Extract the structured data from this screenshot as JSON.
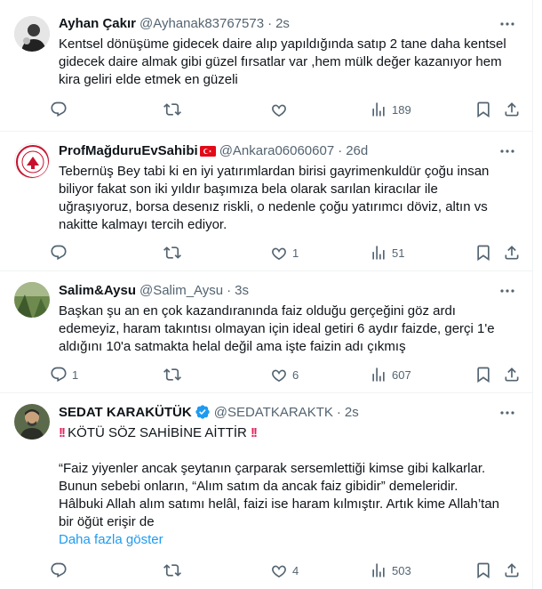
{
  "tweets": [
    {
      "name": "Ayhan Çakır",
      "handle": "@Ayhanak83767573",
      "time": "2s",
      "lines": [
        "Kentsel dönüşüme gidecek daire alıp yapıldığında satıp 2 tane daha kentsel",
        "gidecek daire almak gibi güzel fırsatlar var ,hem mülk değer kazanıyor hem",
        "kira geliri elde etmek en güzeli"
      ],
      "replies": "",
      "retweets": "",
      "likes": "",
      "views": "189"
    },
    {
      "name": "ProfMağduruEvSahibi",
      "handle": "@Ankara06060607",
      "time": "26d",
      "lines": [
        "Tebernüş Bey tabi ki en iyi yatırımlardan birisi gayrimenkuldür çoğu insan",
        "biliyor fakat son iki yıldır başımıza bela olarak sarılan kiracılar ile",
        "uğraşıyoruz, borsa desenız riskli, o nedenle çoğu yatırımcı döviz, altın vs",
        "nakitte kalmayı tercih ediyor."
      ],
      "replies": "",
      "retweets": "",
      "likes": "1",
      "views": "51"
    },
    {
      "name": "Salim&Aysu",
      "handle": "@Salim_Aysu",
      "time": "3s",
      "lines": [
        "Başkan şu an en çok kazandıranında faiz olduğu gerçeğini göz ardı",
        "edemeyiz, haram takıntısı olmayan için ideal getiri 6 aydır faizde, gerçi 1'e",
        "aldığını 10'a satmakta helal değil ama işte faizin adı çıkmış"
      ],
      "replies": "1",
      "retweets": "",
      "likes": "6",
      "views": "607"
    },
    {
      "name": "SEDAT KARAKÜTÜK",
      "handle": "@SEDATKARAKTK",
      "time": "2s",
      "headline": "KÖTÜ SÖZ SAHİBİNE AİTTİR",
      "lines": [
        "“Faiz yiyenler ancak şeytanın çarparak sersemlettiği kimse gibi kalkarlar.",
        "Bunun sebebi onların, “Alım satım da ancak faiz gibidir” demeleridir.",
        "Hâlbuki Allah alım satımı helâl, faizi ise haram kılmıştır. Artık kime Allah’tan",
        "bir öğüt erişir de"
      ],
      "show_more": "Daha fazla göster",
      "replies": "",
      "retweets": "",
      "likes": "4",
      "views": "503"
    }
  ],
  "icons": {
    "reply": "reply-icon",
    "retweet": "retweet-icon",
    "like": "heart-icon",
    "views": "views-icon",
    "bookmark": "bookmark-icon",
    "share": "share-icon",
    "more": "more-icon"
  },
  "colors": {
    "text": "#0f1419",
    "secondary": "#536471",
    "link": "#1d9bf0",
    "verified": "#1d9bf0",
    "emphasis": "#e0245e"
  }
}
